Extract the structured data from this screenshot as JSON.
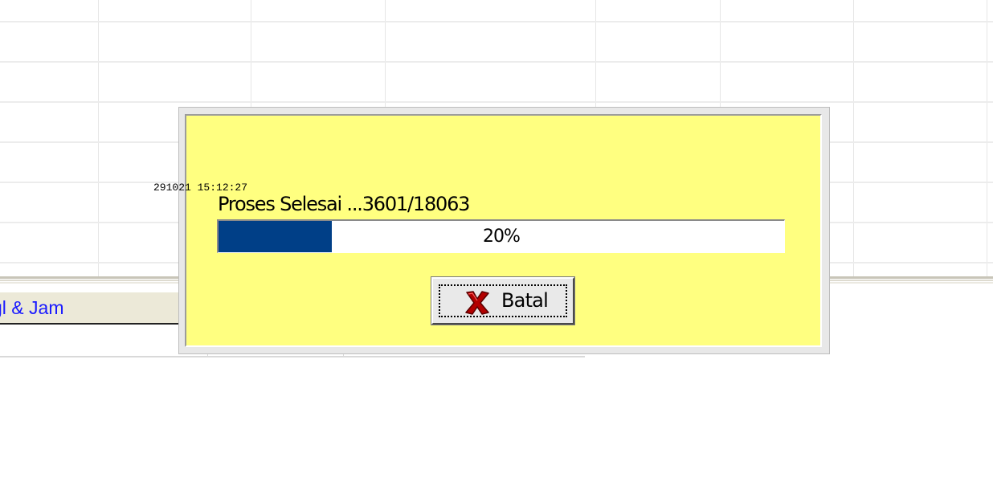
{
  "background": {
    "lower_grid_header": "gl & Jam",
    "timestamp": "291021 15:12:27"
  },
  "dialog": {
    "status_text": "Proses Selesai ...3601/18063",
    "progress": {
      "percent": 20,
      "label": "20%",
      "fill_color": "#003f87"
    },
    "cancel_button": {
      "label": "Batal",
      "icon": "red-x-icon"
    },
    "background_color": "#ffff80"
  }
}
